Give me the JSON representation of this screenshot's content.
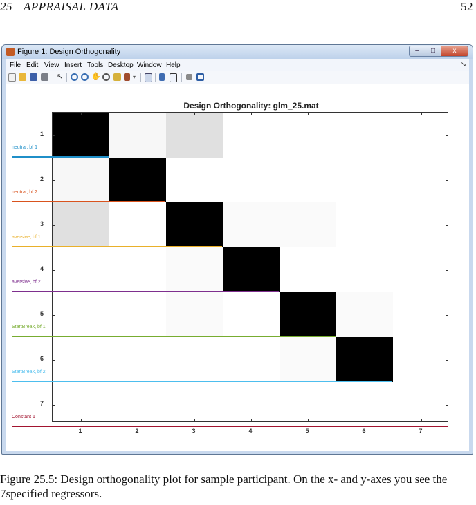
{
  "page_header": {
    "chapter_number": "25",
    "chapter_title": "APPRAISAL DATA",
    "page_number": "52"
  },
  "window": {
    "title": "Figure 1: Design Orthogonality",
    "buttons": {
      "minimize": "–",
      "maximize": "□",
      "close": "x"
    },
    "menu": [
      "File",
      "Edit",
      "View",
      "Insert",
      "Tools",
      "Desktop",
      "Window",
      "Help"
    ],
    "toolbar_icons": [
      "new-figure-icon",
      "open-file-icon",
      "save-icon",
      "print-icon",
      "pointer-icon",
      "zoom-in-icon",
      "zoom-out-icon",
      "pan-icon",
      "rotate-icon",
      "data-cursor-icon",
      "brush-icon",
      "link-icon",
      "colorbar-icon",
      "legend-icon",
      "hide-tools-icon",
      "show-tools-icon"
    ]
  },
  "chart_data": {
    "type": "heatmap",
    "title": "Design Orthogonality: glm_25.mat",
    "x_ticks": [
      "1",
      "2",
      "3",
      "4",
      "5",
      "6",
      "7"
    ],
    "y_ticks": [
      "1",
      "2",
      "3",
      "4",
      "5",
      "6",
      "7"
    ],
    "regressors": [
      {
        "name": "neutral, bf 1",
        "color": "#1f8fc8"
      },
      {
        "name": "neutral, bf 2",
        "color": "#d9531e"
      },
      {
        "name": "aversive, bf 1",
        "color": "#e9b02a"
      },
      {
        "name": "aversive, bf 2",
        "color": "#7e2f8e"
      },
      {
        "name": "StartBreak, bf 1",
        "color": "#77ac30"
      },
      {
        "name": "StartBreak, bf 2",
        "color": "#4dbeee"
      },
      {
        "name": "Constant 1",
        "color": "#a2142f"
      }
    ],
    "matrix": [
      [
        1.0,
        0.03,
        0.12,
        null,
        null,
        null,
        null
      ],
      [
        0.03,
        1.0,
        null,
        null,
        null,
        null,
        null
      ],
      [
        0.12,
        0.0,
        1.0,
        0.02,
        0.02,
        null,
        null
      ],
      [
        null,
        null,
        0.02,
        1.0,
        null,
        null,
        null
      ],
      [
        null,
        null,
        0.02,
        0.0,
        1.0,
        0.02,
        null
      ],
      [
        null,
        null,
        null,
        null,
        0.02,
        1.0,
        null
      ],
      [
        null,
        null,
        null,
        null,
        null,
        null,
        null
      ]
    ],
    "color_scale": "gray (0 = white, 1 = black)"
  },
  "caption": "Figure 25.5: Design orthogonality plot for sample participant. On the x- and y-axes you see the 7specified regressors."
}
